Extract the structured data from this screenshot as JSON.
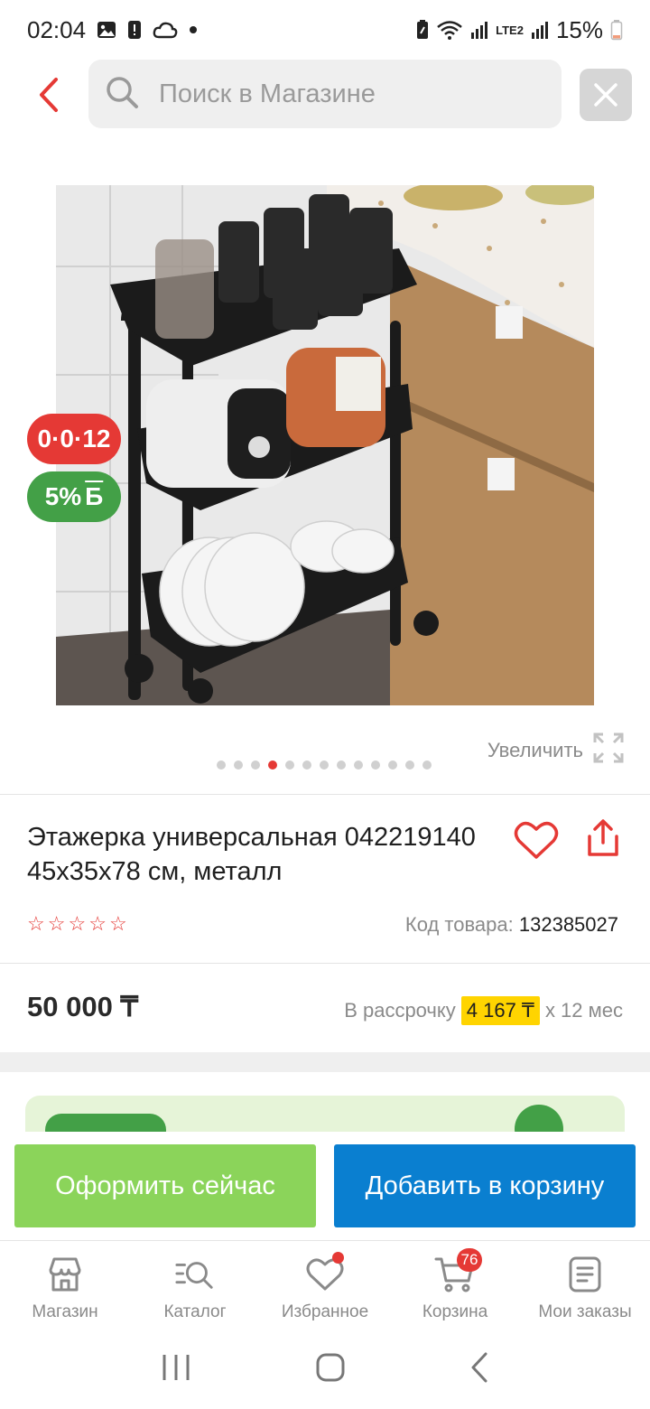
{
  "status_bar": {
    "time": "02:04",
    "network_label": "LTE2",
    "battery_percent": "15%"
  },
  "search": {
    "placeholder": "Поиск в Магазине"
  },
  "product": {
    "badges": {
      "installment": "0·0·12",
      "bonus_percent": "5%",
      "bonus_symbol": "Б"
    },
    "gallery": {
      "zoom_label": "Увеличить",
      "dot_count": 13,
      "active_dot_index": 3
    },
    "title": "Этажерка универсальная 042219140 45x35x78 см, металл",
    "rating_stars": 0,
    "rating_max": 5,
    "sku_label": "Код товара:",
    "sku_value": "132385027",
    "price": "50 000 ₸",
    "installment_label": "В рассрочку",
    "installment_amount": "4 167 ₸",
    "installment_term": "x 12 мес"
  },
  "actions": {
    "checkout_label": "Оформить сейчас",
    "add_to_cart_label": "Добавить в корзину"
  },
  "bottom_nav": {
    "items": [
      {
        "label": "Магазин",
        "icon": "store-icon"
      },
      {
        "label": "Каталог",
        "icon": "catalog-search-icon"
      },
      {
        "label": "Избранное",
        "icon": "heart-icon"
      },
      {
        "label": "Корзина",
        "icon": "cart-icon"
      },
      {
        "label": "Мои заказы",
        "icon": "orders-icon"
      }
    ],
    "cart_count": "76"
  },
  "colors": {
    "accent_red": "#e53935",
    "green": "#43a047",
    "checkout_green": "#8bd45a",
    "cart_blue": "#0a7fd0",
    "installment_yellow": "#ffd400"
  }
}
